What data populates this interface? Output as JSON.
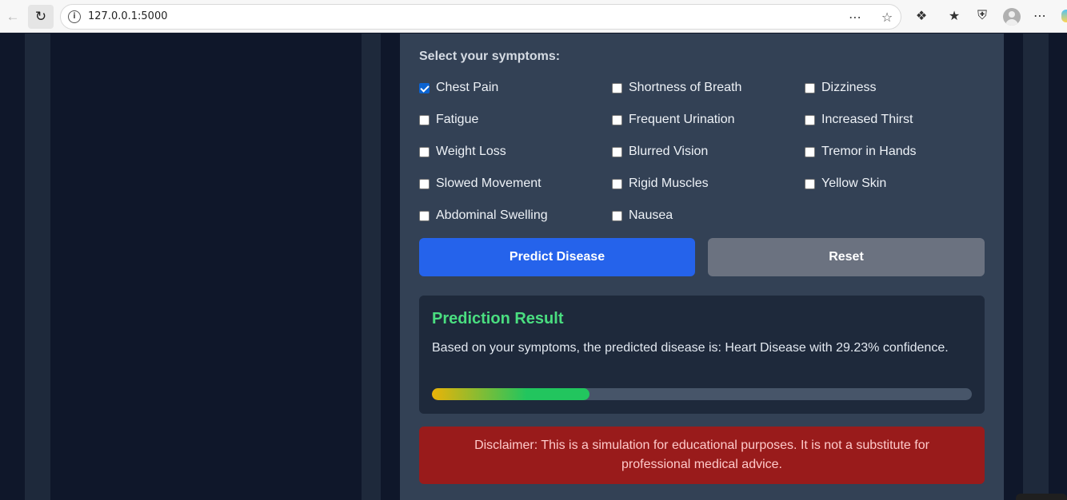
{
  "browser": {
    "url": "127.0.0.1:5000",
    "icons": [
      "back-arrow-icon",
      "reload-icon",
      "site-info-icon",
      "reading-mode-icon",
      "favorite-star-icon",
      "extensions-icon",
      "favorites-list-icon",
      "shield-icon",
      "profile-avatar-icon",
      "more-menu-icon",
      "copilot-icon"
    ]
  },
  "form": {
    "section_label": "Select your symptoms:",
    "symptoms": [
      {
        "label": "Chest Pain",
        "checked": true
      },
      {
        "label": "Shortness of Breath",
        "checked": false
      },
      {
        "label": "Dizziness",
        "checked": false
      },
      {
        "label": "Fatigue",
        "checked": false
      },
      {
        "label": "Frequent Urination",
        "checked": false
      },
      {
        "label": "Increased Thirst",
        "checked": false
      },
      {
        "label": "Weight Loss",
        "checked": false
      },
      {
        "label": "Blurred Vision",
        "checked": false
      },
      {
        "label": "Tremor in Hands",
        "checked": false
      },
      {
        "label": "Slowed Movement",
        "checked": false
      },
      {
        "label": "Rigid Muscles",
        "checked": false
      },
      {
        "label": "Yellow Skin",
        "checked": false
      },
      {
        "label": "Abdominal Swelling",
        "checked": false
      },
      {
        "label": "Nausea",
        "checked": false
      }
    ],
    "predict_label": "Predict Disease",
    "reset_label": "Reset"
  },
  "result": {
    "title": "Prediction Result",
    "text": "Based on your symptoms, the predicted disease is: Heart Disease with 29.23% confidence.",
    "confidence_percent": 29.23
  },
  "disclaimer": {
    "text": "Disclaimer: This is a simulation for educational purposes. It is not a substitute for professional medical advice."
  },
  "colors": {
    "page_bg": "#0f172a",
    "card_bg": "#334155",
    "primary_button": "#2563eb",
    "secondary_button": "#6b7280",
    "result_title": "#4ade80",
    "disclaimer_bg": "#991b1b"
  }
}
